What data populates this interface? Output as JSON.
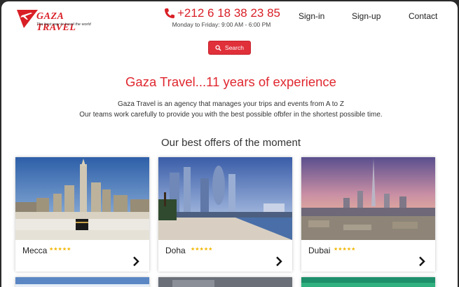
{
  "brand": {
    "name": "GAZA TRAVEL",
    "tagline": "The best way to travel the world",
    "color": "#d91f26"
  },
  "contact": {
    "phone": "+212 6 18 38 23 85",
    "hours": "Monday to Friday: 9:00 AM - 6:00 PM"
  },
  "nav": {
    "signin": "Sign-in",
    "signup": "Sign-up",
    "contact": "Contact"
  },
  "search": {
    "label": "Search",
    "icon": "search-icon"
  },
  "hero": {
    "title": "Gaza Travel...11 years of experience",
    "line1": "Gaza Travel is an agency that manages your trips and events from A to Z",
    "line2": "Our teams work carefully to provide you with the best possible ofbfer in the shortest possible time."
  },
  "offers": {
    "title": "Our best offers of the moment",
    "cards": [
      {
        "name": "Mecca",
        "stars": "★★★★★",
        "rating": 5
      },
      {
        "name": "Doha",
        "stars": "★★★★★",
        "rating": 5
      },
      {
        "name": "Dubai",
        "stars": "★★★★★",
        "rating": 5
      }
    ]
  },
  "colors": {
    "accent": "#e0303a",
    "star": "#f2b705"
  }
}
